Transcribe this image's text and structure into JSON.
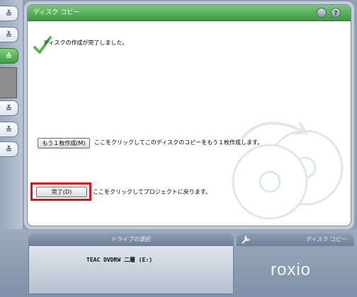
{
  "window": {
    "title": "ディスク コピー",
    "icons": [
      "disc-icon",
      "help-icon"
    ],
    "help_glyph": "?"
  },
  "left_panel": {
    "buttons": [
      "≚",
      "≚",
      "≙",
      "≚",
      "≚",
      "≚"
    ]
  },
  "main": {
    "status_message": "ディスクの作成が完了しました。",
    "another_copy": {
      "button_label": "もう１枚作成(M)",
      "description": "ここをクリックしてこのディスクのコピーをもう１枚作成します。"
    },
    "finish": {
      "button_label": "完了(D)",
      "description": "ここをクリックしてプロジェクトに戻ります。"
    }
  },
  "bottom_bar": {
    "drive_tab_label": "ドライブの選択",
    "drive_name": "TEAC DVDRW 二層 (E:)",
    "disc_copy_tab_label": "ディスク コピー",
    "logo_text": "roxio"
  },
  "colors": {
    "title_green": "#4ea94f",
    "highlight_red": "#e0121a"
  }
}
